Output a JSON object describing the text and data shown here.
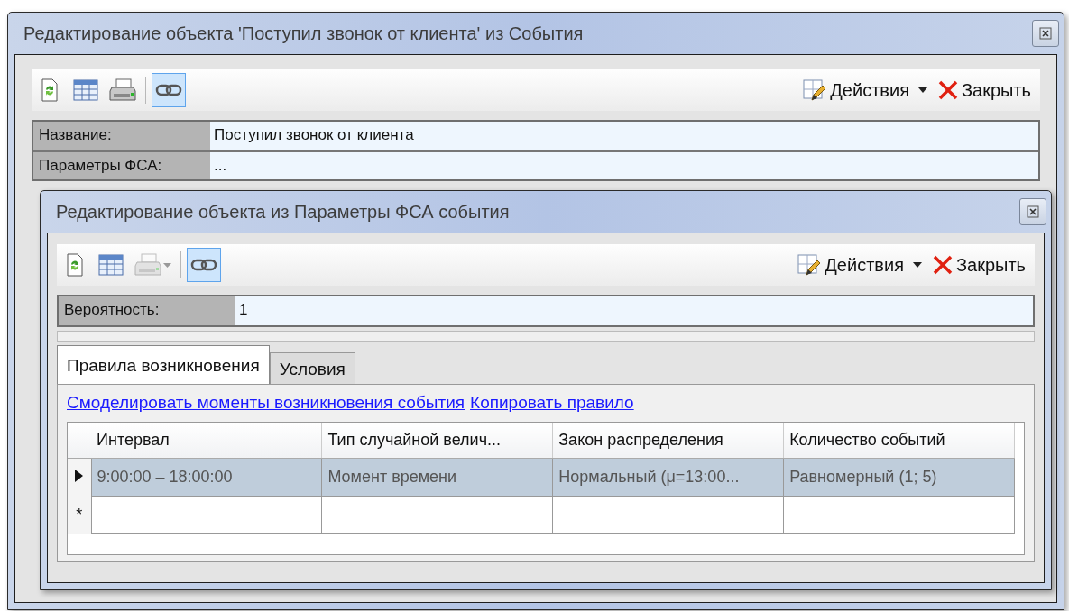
{
  "outer_window": {
    "title": "Редактирование объекта 'Поступил звонок от клиента' из События",
    "toolbar": {
      "tools": [
        {
          "kind": "refresh",
          "disabled": false,
          "pressed": false,
          "has_menu": false
        },
        {
          "kind": "table",
          "disabled": false,
          "pressed": false,
          "has_menu": false
        },
        {
          "kind": "print",
          "disabled": false,
          "pressed": false,
          "has_menu": false
        },
        {
          "kind": "link",
          "disabled": false,
          "pressed": true,
          "has_menu": false
        }
      ],
      "actions": "Действия",
      "close": "Закрыть"
    },
    "fields": [
      {
        "label": "Название:",
        "value": "Поступил звонок от клиента"
      },
      {
        "label": "Параметры ФСА:",
        "value": "..."
      }
    ]
  },
  "inner_window": {
    "title": "Редактирование объекта из Параметры ФСА события",
    "toolbar": {
      "tools": [
        {
          "kind": "refresh",
          "disabled": false,
          "pressed": false,
          "has_menu": false
        },
        {
          "kind": "table",
          "disabled": false,
          "pressed": false,
          "has_menu": false
        },
        {
          "kind": "print",
          "disabled": true,
          "pressed": false,
          "has_menu": true
        },
        {
          "kind": "link",
          "disabled": false,
          "pressed": true,
          "has_menu": false
        }
      ],
      "actions": "Действия",
      "close": "Закрыть"
    },
    "fields": [
      {
        "label": "Вероятность:",
        "value": "1"
      }
    ],
    "tabs": [
      {
        "label": "Правила возникновения",
        "selected": true
      },
      {
        "label": "Условия",
        "selected": false
      }
    ],
    "links": [
      "Смоделировать моменты возникновения события",
      "Копировать правило"
    ],
    "table": {
      "columns": [
        "Интервал",
        "Тип случайной велич...",
        "Закон распределения",
        "Количество событий"
      ],
      "rows": [
        {
          "kind": "current",
          "selected": true,
          "cells": [
            "9:00:00 – 18:00:00",
            "Момент времени",
            "Нормальный (μ=13:00...",
            "Равномерный (1; 5)"
          ]
        },
        {
          "kind": "new",
          "selected": false,
          "marker": "*"
        }
      ]
    }
  }
}
